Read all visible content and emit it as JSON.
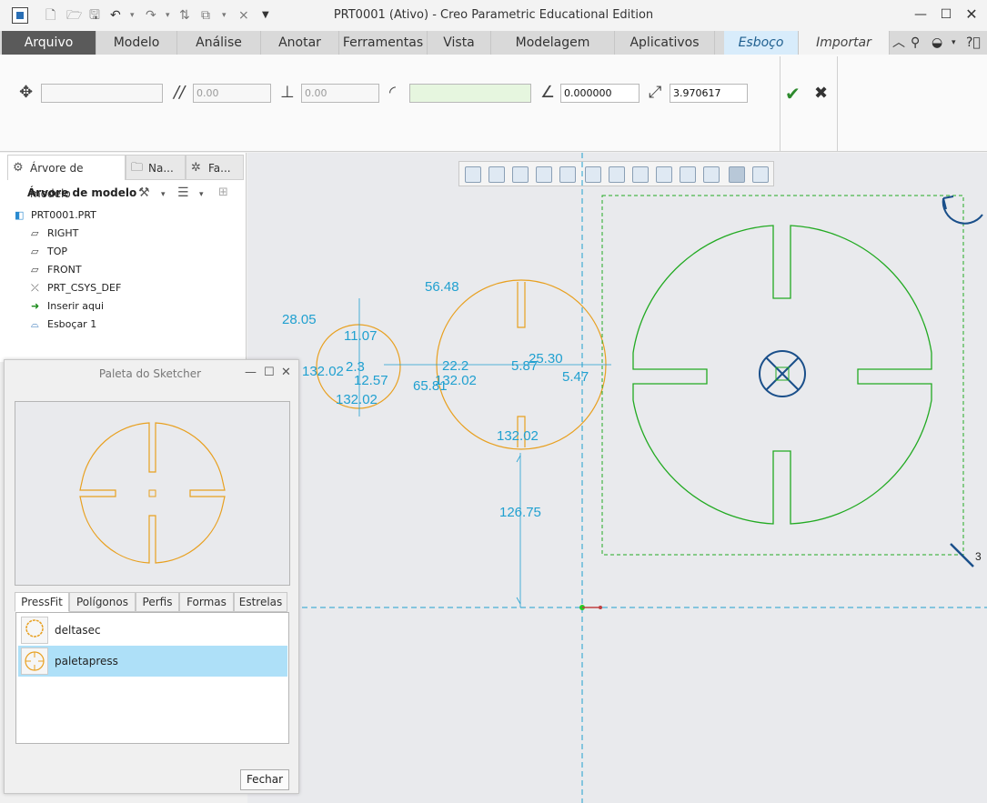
{
  "window": {
    "title": "PRT0001 (Ativo) - Creo Parametric Educational Edition",
    "controls": [
      "minimize",
      "maximize",
      "close"
    ]
  },
  "ribbon_tabs": [
    {
      "label": "Arquivo"
    },
    {
      "label": "Modelo"
    },
    {
      "label": "Análise"
    },
    {
      "label": "Anotar"
    },
    {
      "label": "Ferramentas"
    },
    {
      "label": "Vista"
    },
    {
      "label": "Modelagem flexível"
    },
    {
      "label": "Aplicativos"
    },
    {
      "label": "Esboço"
    },
    {
      "label": "Importar seção"
    }
  ],
  "dashboard": {
    "position_field": "",
    "offset_1": "0.00",
    "offset_2": "0.00",
    "reference_field": "",
    "angle": "0.000000",
    "scale": "3.970617"
  },
  "model_tree": {
    "tabs": [
      "Árvore de modelo",
      "Na...",
      "Fa..."
    ],
    "header": "Árvore de modelo",
    "items": [
      {
        "label": "PRT0001.PRT",
        "icon": "part-icon"
      },
      {
        "label": "RIGHT",
        "icon": "datum-plane-icon"
      },
      {
        "label": "TOP",
        "icon": "datum-plane-icon"
      },
      {
        "label": "FRONT",
        "icon": "datum-plane-icon"
      },
      {
        "label": "PRT_CSYS_DEF",
        "icon": "csys-icon"
      },
      {
        "label": "Inserir aqui",
        "icon": "insert-arrow-icon"
      },
      {
        "label": "Esboçar 1",
        "icon": "sketch-icon"
      }
    ]
  },
  "palette": {
    "title": "Paleta do Sketcher",
    "tabs": [
      "PressFit",
      "Polígonos",
      "Perfis",
      "Formas",
      "Estrelas"
    ],
    "active_tab": "PressFit",
    "items": [
      {
        "label": "deltasec",
        "selected": false
      },
      {
        "label": "paletapress",
        "selected": true
      }
    ],
    "close_label": "Fechar"
  },
  "dimensions": {
    "d1": "28.05",
    "d2": "11.07",
    "d3": "132.02",
    "d4": "2.3",
    "d5": "12.57",
    "d6": "132.02",
    "d7": "56.48",
    "d8": "65.81",
    "d9": "22.2",
    "d10": "132.02",
    "d11": "25.30",
    "d12": "5.87",
    "d13": "5.47",
    "d14": "132.02",
    "d15": "126.75",
    "d16": "3"
  },
  "colors": {
    "sketch_orange": "#e8a020",
    "preview_green": "#22aa22",
    "dimension_cyan": "#20a0d0",
    "construction_blue": "#1a4f8a"
  }
}
